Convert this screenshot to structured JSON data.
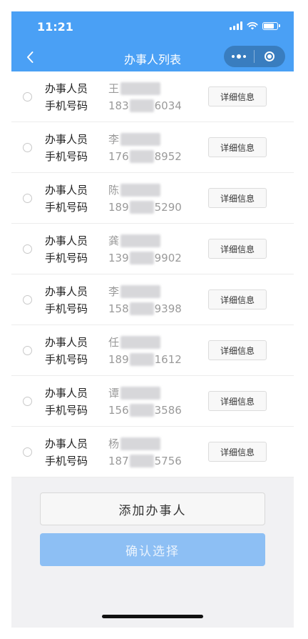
{
  "status_bar": {
    "time": "11:21",
    "icons": [
      "cellular-signal-icon",
      "wifi-icon",
      "battery-icon"
    ]
  },
  "nav_bar": {
    "back_icon": "chevron-left-icon",
    "title": "办事人列表",
    "capsule_icons": [
      "more-dots-icon",
      "close-target-icon"
    ]
  },
  "labels": {
    "name": "办事人员",
    "phone": "手机号码",
    "detail_button": "详细信息"
  },
  "agents": [
    {
      "name_prefix": "王",
      "phone_prefix": "183",
      "phone_suffix": "6034"
    },
    {
      "name_prefix": "李",
      "phone_prefix": "176",
      "phone_suffix": "8952"
    },
    {
      "name_prefix": "陈",
      "phone_prefix": "189",
      "phone_suffix": "5290"
    },
    {
      "name_prefix": "龚",
      "phone_prefix": "139",
      "phone_suffix": "9902"
    },
    {
      "name_prefix": "李",
      "phone_prefix": "158",
      "phone_suffix": "9398"
    },
    {
      "name_prefix": "任",
      "phone_prefix": "189",
      "phone_suffix": "1612"
    },
    {
      "name_prefix": "谭",
      "phone_prefix": "156",
      "phone_suffix": "3586"
    },
    {
      "name_prefix": "杨",
      "phone_prefix": "187",
      "phone_suffix": "5756"
    }
  ],
  "actions": {
    "add_label": "添加办事人",
    "confirm_label": "确认选择"
  },
  "colors": {
    "primary": "#4aa0f5",
    "confirm_disabled": "#8dbff4",
    "background": "#f1f1f3"
  }
}
